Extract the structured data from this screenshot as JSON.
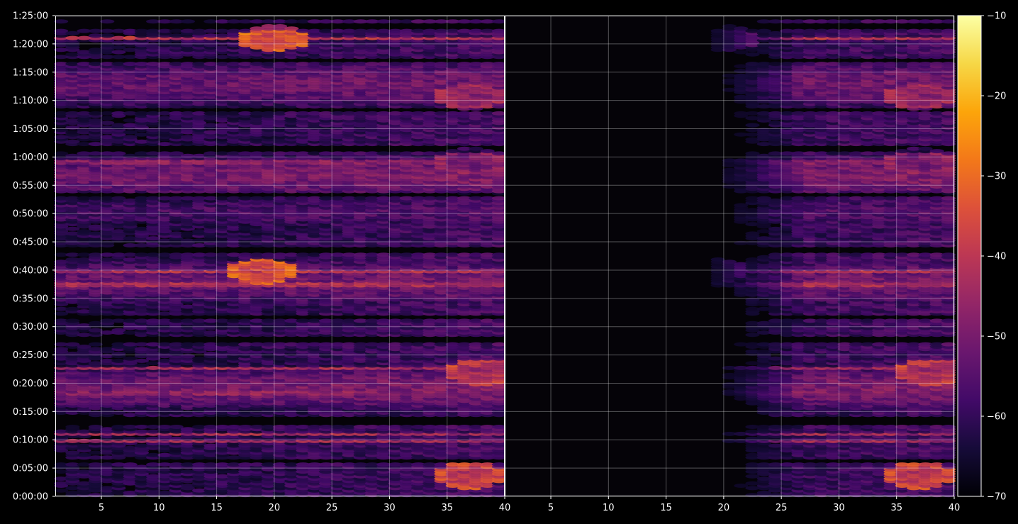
{
  "chart_data": {
    "type": "heatmap",
    "title": "",
    "xlabel": "",
    "ylabel": "",
    "background": "#000000",
    "grid": true,
    "colormap": "inferno",
    "colorbar": {
      "min": -70,
      "max": -10,
      "ticks": [
        -10,
        -20,
        -30,
        -40,
        -50,
        -60,
        -70
      ],
      "tick_labels": [
        "−10",
        "−20",
        "−30",
        "−40",
        "−50",
        "−60",
        "−70"
      ]
    },
    "y_axis": {
      "range_seconds": [
        0,
        5100
      ],
      "tick_values": [
        0,
        300,
        600,
        900,
        1200,
        1500,
        1800,
        2100,
        2400,
        2700,
        3000,
        3300,
        3600,
        3900,
        4200,
        4500,
        4800,
        5100
      ],
      "tick_labels": [
        "0:00:00",
        "0:05:00",
        "0:10:00",
        "0:15:00",
        "0:20:00",
        "0:25:00",
        "0:30:00",
        "0:35:00",
        "0:40:00",
        "0:45:00",
        "0:50:00",
        "0:55:00",
        "1:00:00",
        "1:05:00",
        "1:10:00",
        "1:15:00",
        "1:20:00",
        "1:25:00"
      ]
    },
    "panels": [
      {
        "name": "left",
        "x_range": [
          1,
          40
        ],
        "x_ticks": [
          5,
          10,
          15,
          20,
          25,
          30,
          35,
          40
        ],
        "x_tick_labels": [
          "5",
          "10",
          "15",
          "20",
          "25",
          "30",
          "35",
          "40"
        ],
        "data_x_max": 39.5,
        "base_start": 1,
        "x_fade_end": 1,
        "base_slope": 0.012
      },
      {
        "name": "right",
        "x_range": [
          1,
          40
        ],
        "x_ticks": [
          5,
          10,
          15,
          20,
          25,
          30,
          35,
          40
        ],
        "x_tick_labels": [
          "5",
          "10",
          "15",
          "20",
          "25",
          "30",
          "35",
          "40"
        ],
        "data_x_max": 39.5,
        "base_start": 15,
        "x_fade_end": 27,
        "base_slope": 0.02
      }
    ],
    "time_step_seconds": 25,
    "x_step": 1,
    "time_bands": [
      {
        "t": 1150,
        "v": -50,
        "w": 260
      },
      {
        "t": 2280,
        "v": -52,
        "w": 300
      },
      {
        "t": 3400,
        "v": -50,
        "w": 260
      },
      {
        "t": 4380,
        "v": -52,
        "w": 300
      },
      {
        "t": 3020,
        "v": -56,
        "w": 200
      }
    ],
    "hot_lines": [
      {
        "t": 585,
        "v": -42
      },
      {
        "t": 665,
        "v": -42
      },
      {
        "t": 2385,
        "v": -39
      },
      {
        "t": 2250,
        "v": -41
      },
      {
        "t": 4860,
        "v": -38
      },
      {
        "t": 1360,
        "v": -42
      },
      {
        "t": 1100,
        "v": -46
      },
      {
        "t": 3550,
        "v": -46
      }
    ],
    "dark_lines": [
      {
        "t": 380,
        "w": 30
      },
      {
        "t": 800,
        "w": 40
      },
      {
        "t": 1660,
        "w": 40
      },
      {
        "t": 1900,
        "w": 30
      },
      {
        "t": 2620,
        "w": 40
      },
      {
        "t": 3200,
        "w": 30
      },
      {
        "t": 3690,
        "w": 40
      },
      {
        "t": 4100,
        "w": 30
      },
      {
        "t": 4620,
        "w": 30
      },
      {
        "t": 4980,
        "w": 40
      }
    ],
    "hotspots": [
      {
        "x": 37,
        "t": 220,
        "v": -42
      },
      {
        "x": 37,
        "t": 4240,
        "v": -48
      },
      {
        "x": 37,
        "t": 3560,
        "v": -52
      },
      {
        "x": 38,
        "t": 1320,
        "v": -44
      },
      {
        "x": 20,
        "t": 4860,
        "v": -37
      },
      {
        "x": 19,
        "t": 2390,
        "v": -38
      }
    ]
  }
}
